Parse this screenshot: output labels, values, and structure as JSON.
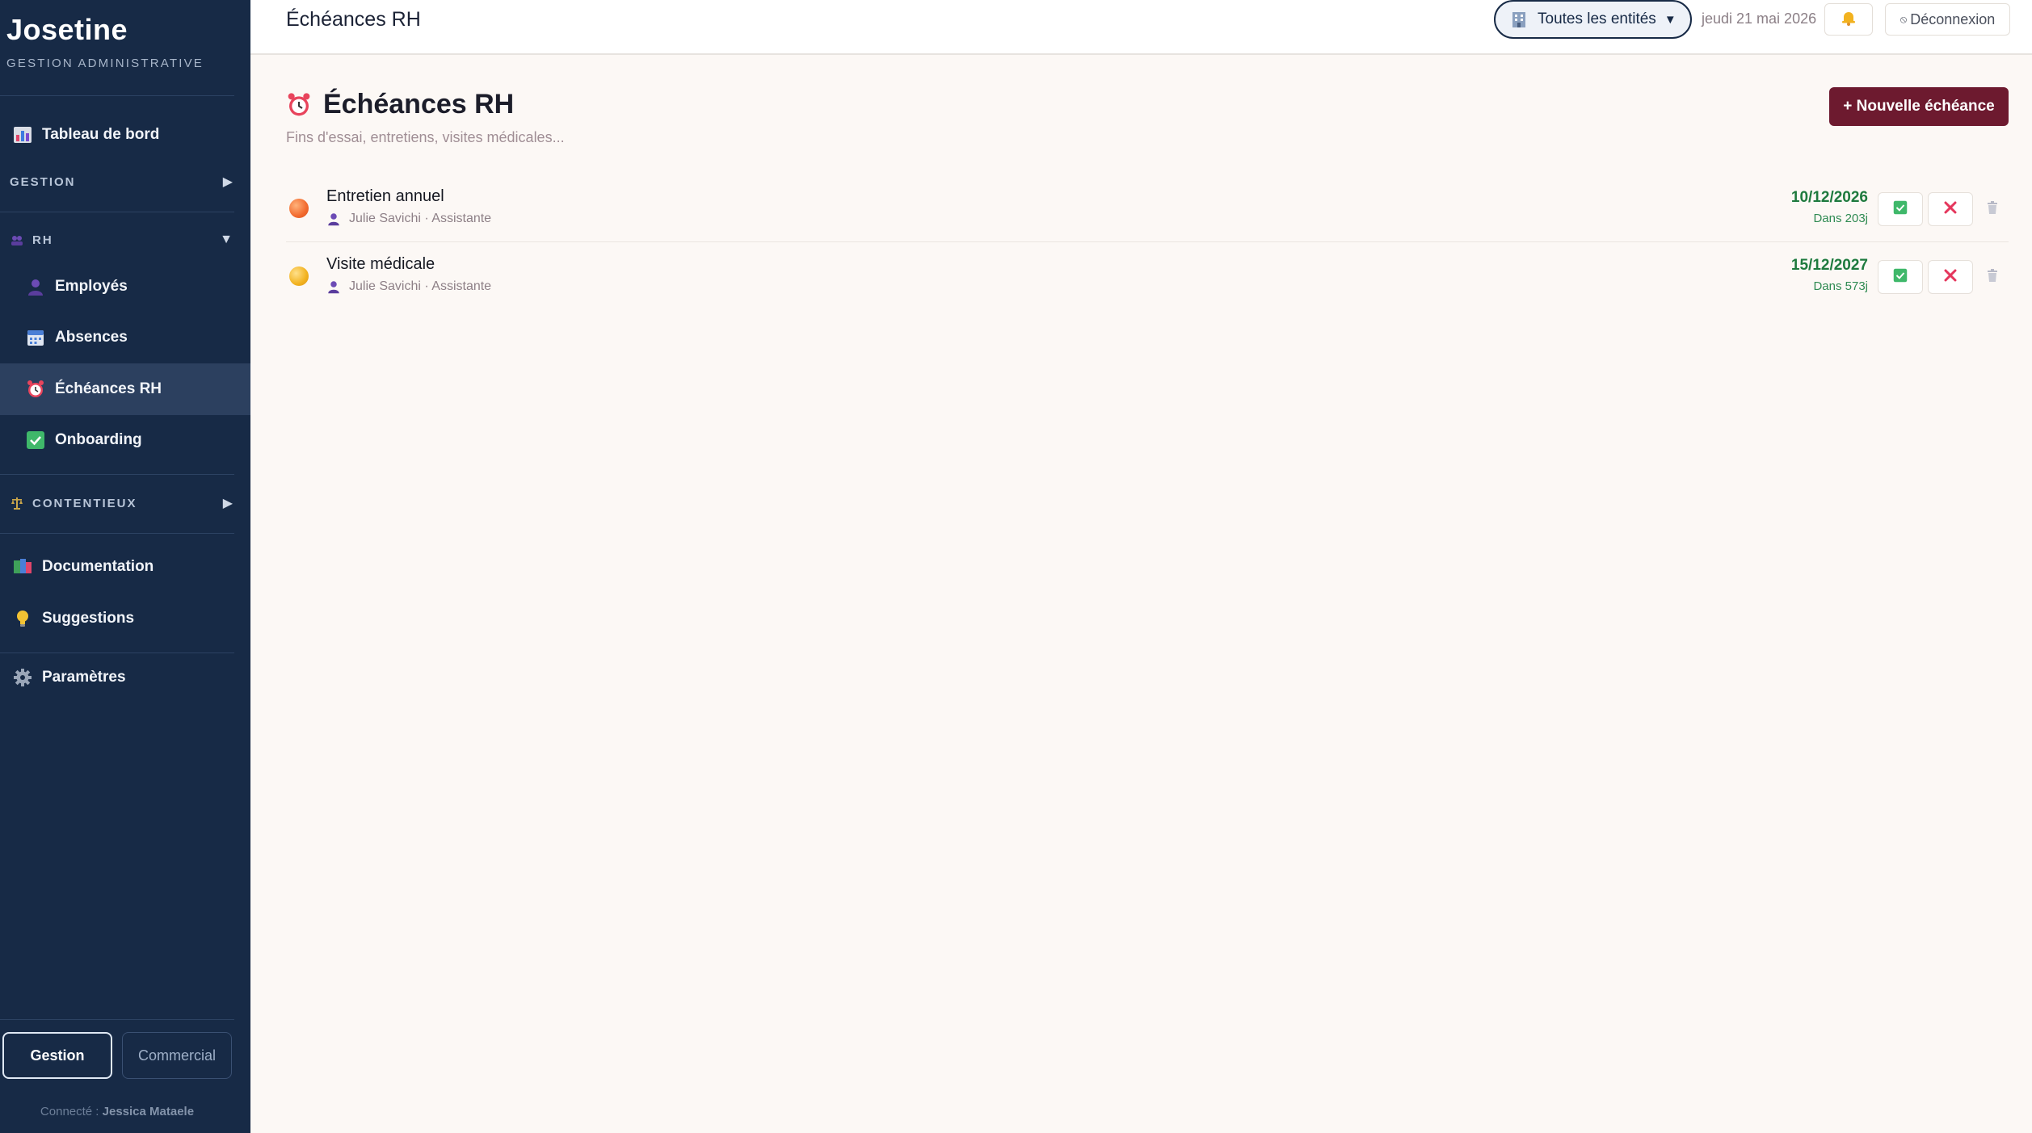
{
  "sidebar": {
    "brand_title": "Josetine",
    "brand_subtitle": "GESTION ADMINISTRATIVE",
    "dashboard_label": "Tableau de bord",
    "section_gestion": "GESTION",
    "section_rh": "RH",
    "rh_items": [
      {
        "label": "Employés",
        "icon": "person-icon"
      },
      {
        "label": "Absences",
        "icon": "calendar-icon"
      },
      {
        "label": "Échéances RH",
        "icon": "alarm-clock-icon"
      },
      {
        "label": "Onboarding",
        "icon": "check-box-icon"
      }
    ],
    "section_contentieux": "CONTENTIEUX",
    "documentation_label": "Documentation",
    "suggestions_label": "Suggestions",
    "settings_label": "Paramètres",
    "mode_gestion": "Gestion",
    "mode_commercial": "Commercial",
    "connected_prefix": "Connecté :",
    "connected_user": "Jessica Mataele"
  },
  "topbar": {
    "title": "Échéances RH",
    "entity_selector": "Toutes les entités",
    "date": "jeudi 21 mai 2026",
    "logout": "Déconnexion"
  },
  "main": {
    "title": "Échéances RH",
    "subtitle": "Fins d'essai, entretiens, visites médicales...",
    "new_button": "+ Nouvelle échéance",
    "rows": [
      {
        "title": "Entretien annuel",
        "person": "Julie Savichi · Assistante",
        "date": "10/12/2026",
        "in": "Dans 203j",
        "dot_color": "#f26a2e"
      },
      {
        "title": "Visite médicale",
        "person": "Julie Savichi · Assistante",
        "date": "15/12/2027",
        "in": "Dans 573j",
        "dot_color": "#f2b21f"
      }
    ]
  },
  "colors": {
    "sidebar_bg": "#172a46",
    "accent": "#6d1a2f",
    "date_green": "#1e7a3e"
  }
}
